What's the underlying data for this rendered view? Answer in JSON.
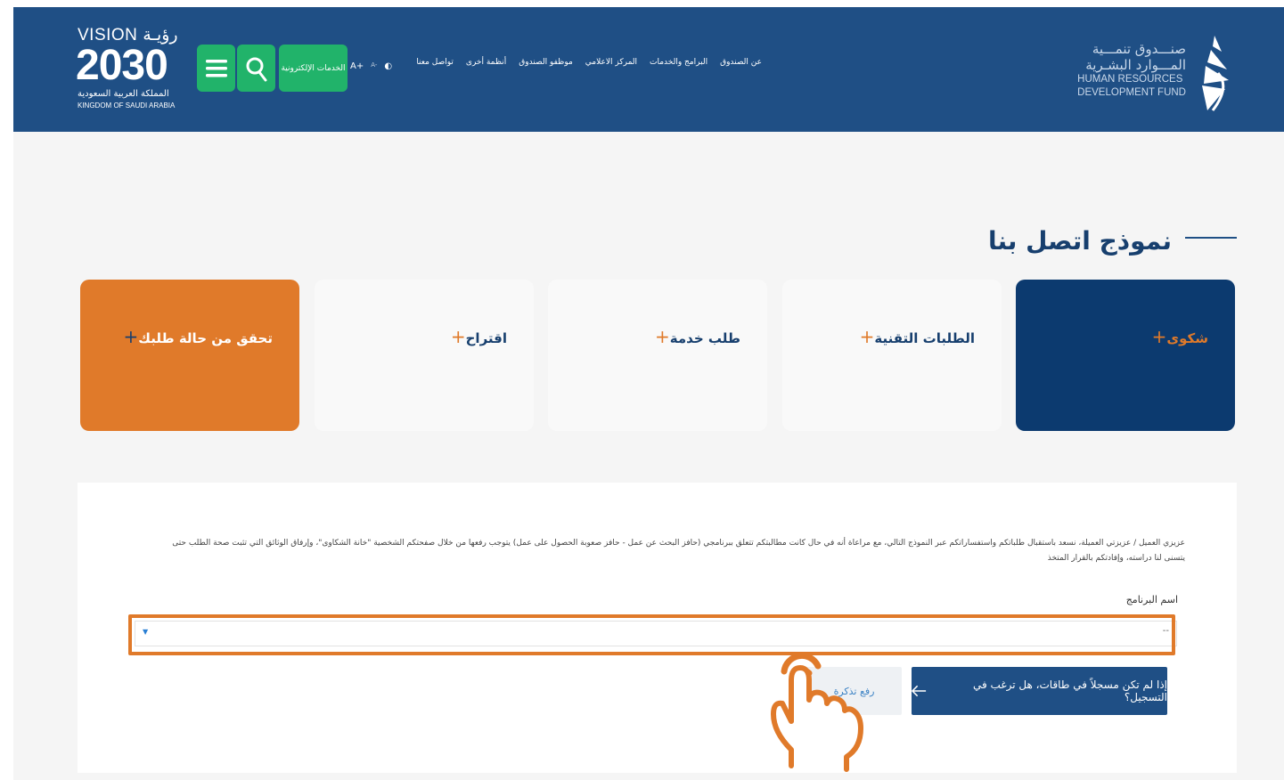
{
  "header": {
    "fund_logo": {
      "ar_line1": "صنـــدوق تنمـــية",
      "ar_line2": "المـــوارد البشـرية",
      "en_line1": "HUMAN RESOURCES",
      "en_line2": "DEVELOPMENT FUND"
    },
    "nav_items": [
      "عن الصندوق",
      "البرامج والخدمات",
      "المركز الاعلامي",
      "موظفو الصندوق",
      "أنظمة أخرى",
      "تواصل معنا"
    ],
    "a11y": {
      "font_increase": "A+",
      "font_decrease": "A-",
      "contrast": "◐"
    },
    "eservices_label": "الخدمات الإلكترونية",
    "vision_logo": {
      "top": "VISION رؤيـة",
      "year": "2030",
      "ar": "المملكة العربية السعودية",
      "en": "KINGDOM OF SAUDI ARABIA"
    },
    "colors": {
      "primary": "#1f4f85",
      "green": "#21b36a",
      "orange": "#e07a2a",
      "navy": "#0c3a6f"
    }
  },
  "page": {
    "title": "نموذج اتصل بنا"
  },
  "cards": [
    {
      "label": "شكوى",
      "active": true
    },
    {
      "label": "الطلبات التقنية",
      "active": false
    },
    {
      "label": "طلب خدمة",
      "active": false
    },
    {
      "label": "اقتراح",
      "active": false
    },
    {
      "label": "تحقق من حالة طلبك",
      "active": false
    }
  ],
  "form": {
    "intro": "عزيزي العميل / عزيزتي العميلة، نسعد باستقبال طلباتكم واستفساراتكم عبر النموذج التالي، مع مراعاة أنه في حال كانت مطالبتكم تتعلق ببرنامجي (حافز البحث عن عمل - حافز صعوبة الحصول على عمل) يتوجب رفعها من خلال صفحتكم الشخصية \"خانة الشكاوى\"، وإرفاق الوثائق التي تثبت صحة الطلب حتى يتسنى لنا دراسته، وإفادتكم بالقرار المتخذ",
    "program_label": "اسم البرنامج",
    "program_value": "--",
    "register_btn": "إذا لم تكن مسجلاً في طاقات، هل ترغب في التسجيل؟",
    "ticket_btn": "رفع تذكرة"
  }
}
